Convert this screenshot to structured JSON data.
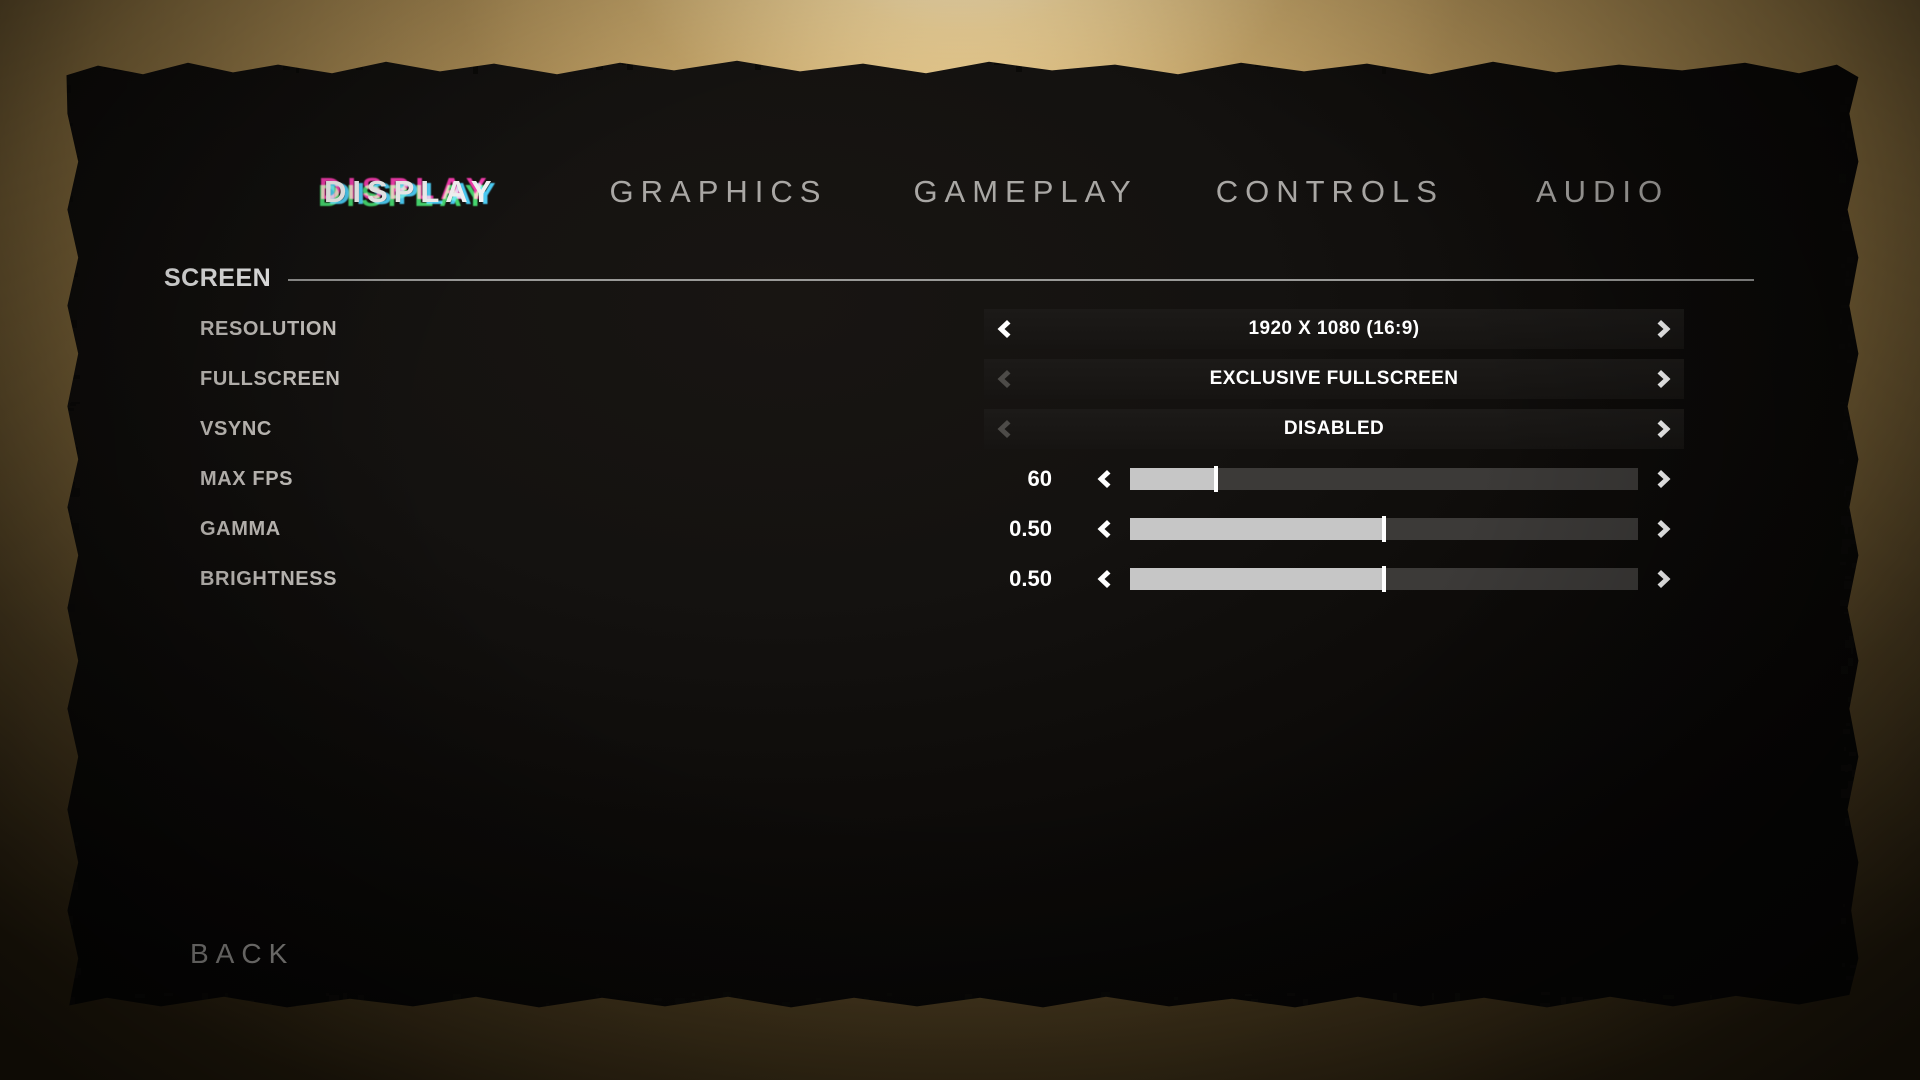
{
  "menu": {
    "tabs": [
      {
        "label": "DISPLAY",
        "active": true
      },
      {
        "label": "GRAPHICS",
        "active": false
      },
      {
        "label": "GAMEPLAY",
        "active": false
      },
      {
        "label": "CONTROLS",
        "active": false
      },
      {
        "label": "AUDIO",
        "active": false
      }
    ],
    "back_label": "BACK"
  },
  "section": {
    "title": "SCREEN"
  },
  "settings": [
    {
      "label": "RESOLUTION",
      "type": "selector",
      "value": "1920 X 1080 (16:9)",
      "left_arrow_enabled": true,
      "right_arrow_enabled": true
    },
    {
      "label": "FULLSCREEN",
      "type": "selector",
      "value": "EXCLUSIVE FULLSCREEN",
      "left_arrow_enabled": false,
      "right_arrow_enabled": true
    },
    {
      "label": "VSYNC",
      "type": "selector",
      "value": "DISABLED",
      "left_arrow_enabled": false,
      "right_arrow_enabled": true
    },
    {
      "label": "MAX FPS",
      "type": "slider",
      "value": "60",
      "fill_percent": 17,
      "left_arrow_enabled": true,
      "right_arrow_enabled": true
    },
    {
      "label": "GAMMA",
      "type": "slider",
      "value": "0.50",
      "fill_percent": 50,
      "left_arrow_enabled": true,
      "right_arrow_enabled": true
    },
    {
      "label": "BRIGHTNESS",
      "type": "slider",
      "value": "0.50",
      "fill_percent": 50,
      "left_arrow_enabled": true,
      "right_arrow_enabled": true
    }
  ],
  "colors": {
    "panel_bg": "#141210",
    "tab_inactive": "#a9a7a4",
    "tab_active": "#ffffff",
    "label": "#d2cec9",
    "slider_fill": "#c6c6c6",
    "slider_track": "#3c3a38",
    "glitch_magenta": "#ff2fb0",
    "glitch_green": "#39e06a",
    "glitch_cyan": "#3fd2ff",
    "backdrop": "#bb9a5e"
  }
}
